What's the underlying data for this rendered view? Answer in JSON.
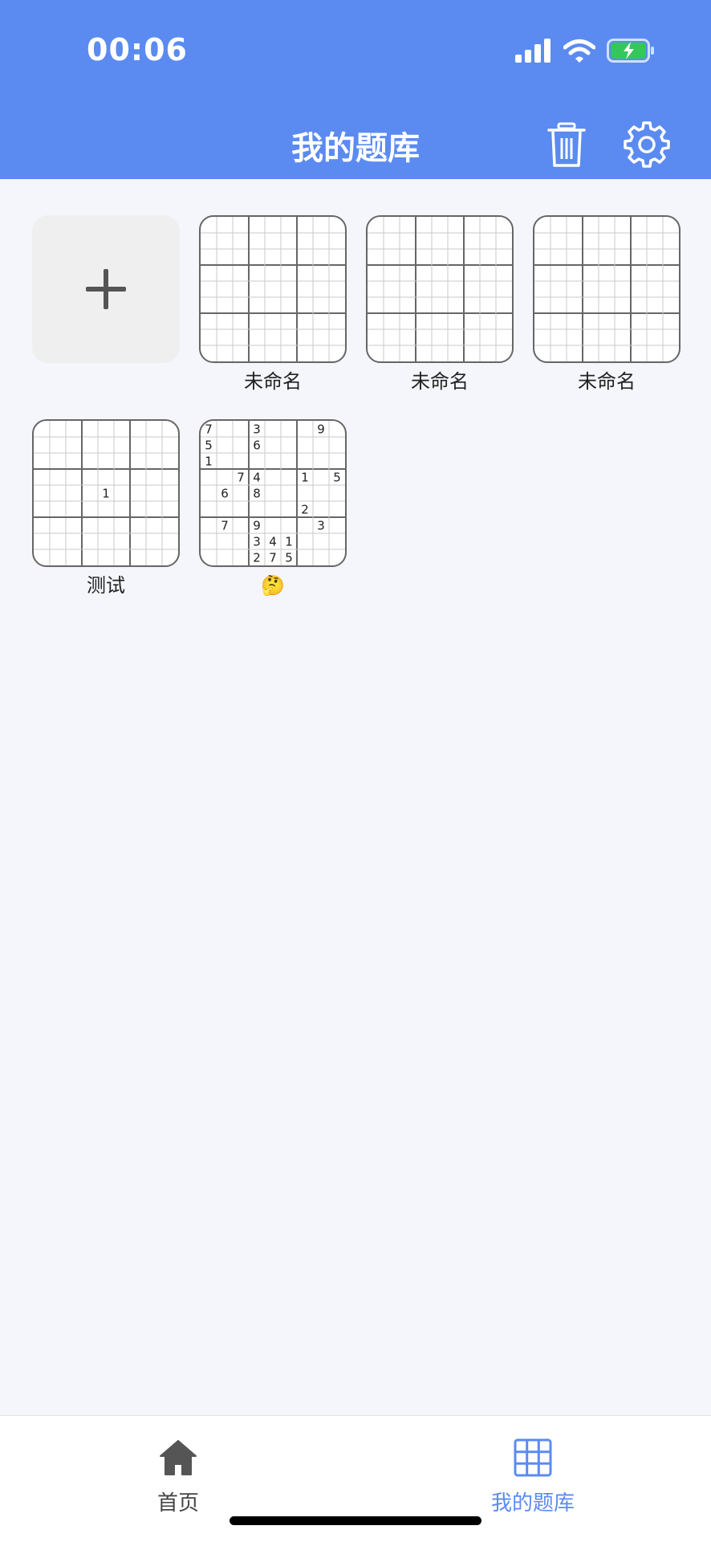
{
  "status_bar": {
    "time": "00:06"
  },
  "header": {
    "title": "我的题库"
  },
  "icons": {
    "trash": "trash-icon",
    "settings": "gear-icon",
    "home": "home-icon",
    "grid": "grid-icon",
    "add": "plus-icon"
  },
  "colors": {
    "accent": "#5b8bf0",
    "background": "#f4f6fb",
    "battery": "#34c759"
  },
  "puzzles": [
    {
      "name": "未命名",
      "cells": []
    },
    {
      "name": "未命名",
      "cells": []
    },
    {
      "name": "未命名",
      "cells": []
    },
    {
      "name": "测试",
      "cells": [
        [
          4,
          4,
          "1"
        ]
      ]
    },
    {
      "name": "🤔",
      "cells": [
        [
          0,
          0,
          "7"
        ],
        [
          0,
          3,
          "3"
        ],
        [
          0,
          7,
          "9"
        ],
        [
          1,
          0,
          "5"
        ],
        [
          1,
          3,
          "6"
        ],
        [
          2,
          0,
          "1"
        ],
        [
          3,
          2,
          "7"
        ],
        [
          3,
          3,
          "4"
        ],
        [
          3,
          6,
          "1"
        ],
        [
          3,
          8,
          "5"
        ],
        [
          4,
          1,
          "6"
        ],
        [
          4,
          3,
          "8"
        ],
        [
          5,
          6,
          "2"
        ],
        [
          6,
          1,
          "7"
        ],
        [
          6,
          3,
          "9"
        ],
        [
          6,
          7,
          "3"
        ],
        [
          7,
          3,
          "3"
        ],
        [
          7,
          4,
          "4"
        ],
        [
          7,
          5,
          "1"
        ],
        [
          8,
          3,
          "2"
        ],
        [
          8,
          4,
          "7"
        ],
        [
          8,
          5,
          "5"
        ]
      ]
    }
  ],
  "tabbar": {
    "home_label": "首页",
    "mine_label": "我的题库"
  }
}
